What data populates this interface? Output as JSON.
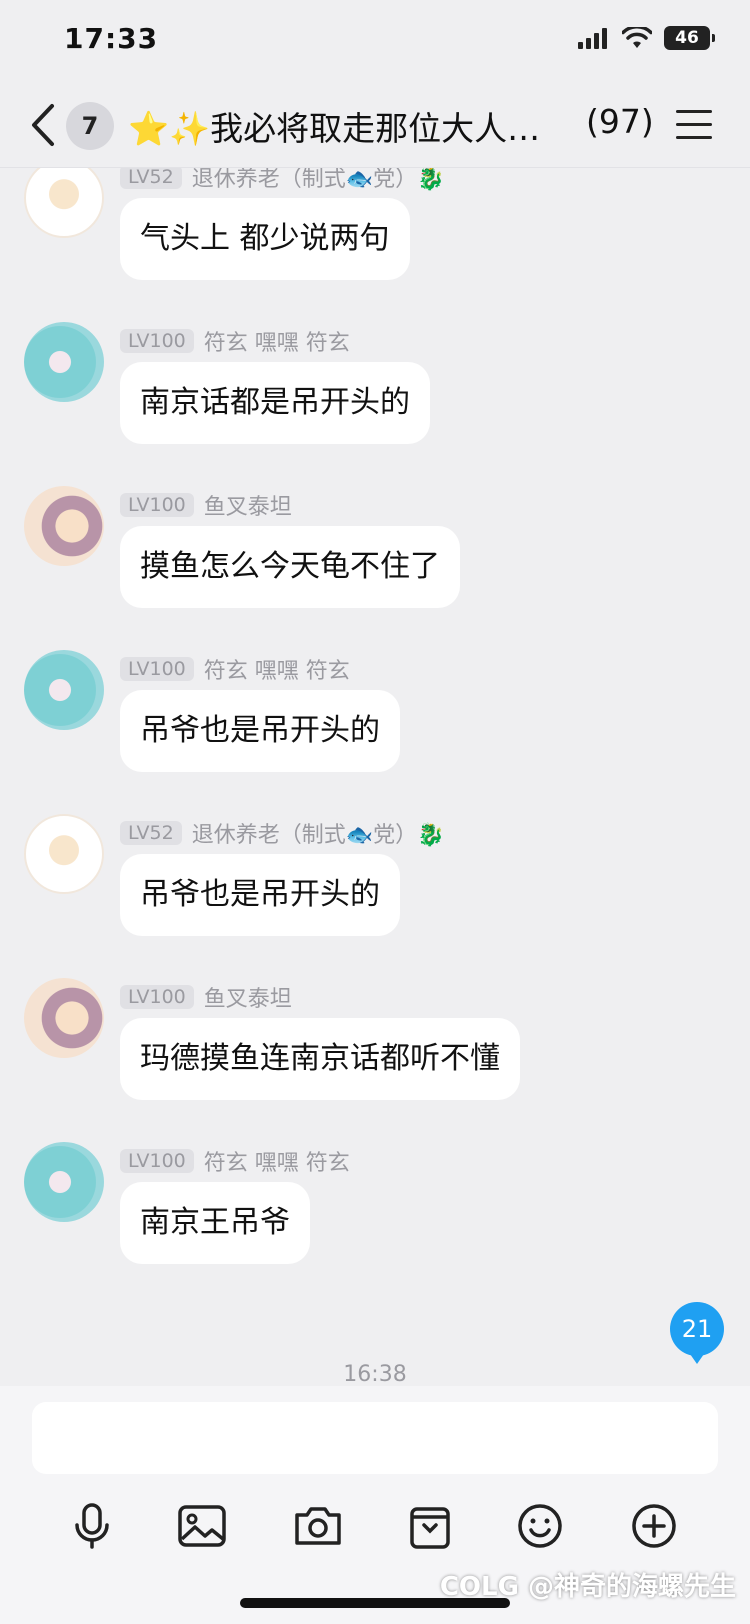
{
  "status_bar": {
    "time": "17:33",
    "battery": "46"
  },
  "header": {
    "unread_count": "7",
    "title": "⭐✨我必将取走那位大人…",
    "member_count": "(97)"
  },
  "messages": [
    {
      "level": "LV52",
      "nick": "退休养老（制式🐟党）🐉",
      "text": "气头上 都少说两句",
      "avatar": "sheep-avatar"
    },
    {
      "level": "LV100",
      "nick": "符玄 嘿嘿 符玄",
      "text": "南京话都是吊开头的",
      "avatar": "fox-avatar"
    },
    {
      "level": "LV100",
      "nick": "鱼叉泰坦",
      "text": "摸鱼怎么今天龟不住了",
      "avatar": "girl-avatar"
    },
    {
      "level": "LV100",
      "nick": "符玄 嘿嘿 符玄",
      "text": "吊爷也是吊开头的",
      "avatar": "fox-avatar"
    },
    {
      "level": "LV52",
      "nick": "退休养老（制式🐟党）🐉",
      "text": "吊爷也是吊开头的",
      "avatar": "sheep-avatar"
    },
    {
      "level": "LV100",
      "nick": "鱼叉泰坦",
      "text": "玛德摸鱼连南京话都听不懂",
      "avatar": "girl-avatar"
    },
    {
      "level": "LV100",
      "nick": "符玄 嘿嘿 符玄",
      "text": "南京王吊爷",
      "avatar": "fox-avatar"
    }
  ],
  "new_message_badge": "21",
  "timestamp": "16:38",
  "composer": {
    "placeholder": "",
    "tools": [
      "microphone-icon",
      "image-icon",
      "camera-icon",
      "wallet-icon",
      "emoji-icon",
      "plus-icon"
    ]
  },
  "watermark": "COLG @神奇的海螺先生",
  "colors": {
    "accent": "#1fa0f2",
    "background": "#efeff1",
    "bubble": "#ffffff"
  }
}
